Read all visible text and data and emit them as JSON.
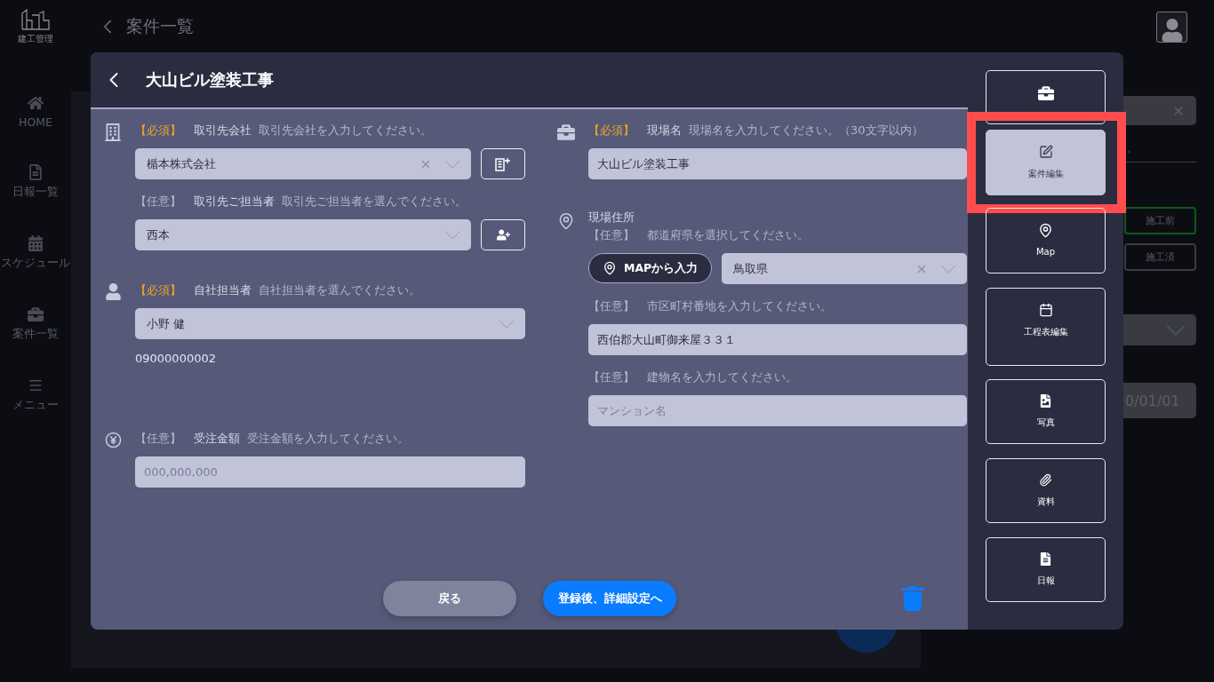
{
  "app": {
    "logo_text": "建工管理",
    "page_title": "案件一覧"
  },
  "sidebar": {
    "items": [
      {
        "label": "HOME"
      },
      {
        "label": "日報一覧"
      },
      {
        "label": "スケジュール"
      },
      {
        "label": "案件一覧"
      },
      {
        "label": "メニュー"
      }
    ]
  },
  "background_panel": {
    "note": "。",
    "status_buttons": [
      {
        "label": "施工前",
        "selected": true
      },
      {
        "label": "施工済",
        "selected": false
      }
    ],
    "date_value": "0/01/01"
  },
  "dialog": {
    "title": "大山ビル塗装工事",
    "columns": [
      [
        {
          "items": [
            {
              "kind": "label",
              "tag": "【必須】",
              "required": true,
              "name": "取引先会社",
              "hint": "取引先会社を入力してください。"
            },
            {
              "kind": "select",
              "value": "楯本株式会社",
              "clearable": true,
              "add_button": true
            },
            {
              "kind": "label",
              "tag": "【任意】",
              "required": false,
              "name": "取引先ご担当者",
              "hint": "取引先ご担当者を選んでください。"
            },
            {
              "kind": "select",
              "value": "西本",
              "clearable": false,
              "add_button": true
            }
          ]
        },
        {
          "items": [
            {
              "kind": "label",
              "tag": "【必須】",
              "required": true,
              "name": "自社担当者",
              "hint": "自社担当者を選んでください。"
            },
            {
              "kind": "select",
              "value": "小野 健",
              "clearable": false,
              "add_button": false
            },
            {
              "kind": "text",
              "value": "09000000002"
            }
          ]
        },
        {
          "items": [
            {
              "kind": "label",
              "tag": "【任意】",
              "required": false,
              "name": "受注金額",
              "hint": "受注金額を入力してください。"
            },
            {
              "kind": "input",
              "placeholder": "000,000,000"
            }
          ]
        }
      ],
      [
        {
          "items": [
            {
              "kind": "label",
              "tag": "【必須】",
              "required": true,
              "name": "現場名",
              "hint": "現場名を入力してください。（30文字以内）"
            },
            {
              "kind": "input",
              "value": "大山ビル塗装工事"
            }
          ]
        },
        {
          "items": [
            {
              "kind": "heading",
              "value": "現場住所"
            },
            {
              "kind": "label",
              "tag": "【任意】",
              "required": false,
              "hint": "都道府県を選択してください。"
            },
            {
              "kind": "map_select",
              "button": "MAPから入力",
              "value": "鳥取県",
              "clearable": true
            },
            {
              "kind": "label",
              "tag": "【任意】",
              "required": false,
              "hint": "市区町村番地を入力してください。"
            },
            {
              "kind": "input",
              "value": "西伯郡大山町御来屋３３１"
            },
            {
              "kind": "label",
              "tag": "【任意】",
              "required": false,
              "hint": "建物名を入力してください。"
            },
            {
              "kind": "input",
              "placeholder": "マンション名"
            }
          ]
        }
      ]
    ],
    "buttons": [
      {
        "label": "戻る",
        "kind": "secondary"
      },
      {
        "label": "登録後、詳細設定へ",
        "kind": "primary"
      }
    ],
    "actions": [
      {
        "selected": false
      },
      {
        "label": "案件編集",
        "selected": true,
        "highlight": true
      },
      {
        "label": "Map",
        "selected": false
      },
      {
        "label": "工程表編集",
        "selected": false
      },
      {
        "label": "写真",
        "selected": false
      },
      {
        "label": "資料",
        "selected": false
      },
      {
        "label": "日報",
        "selected": false
      }
    ]
  }
}
